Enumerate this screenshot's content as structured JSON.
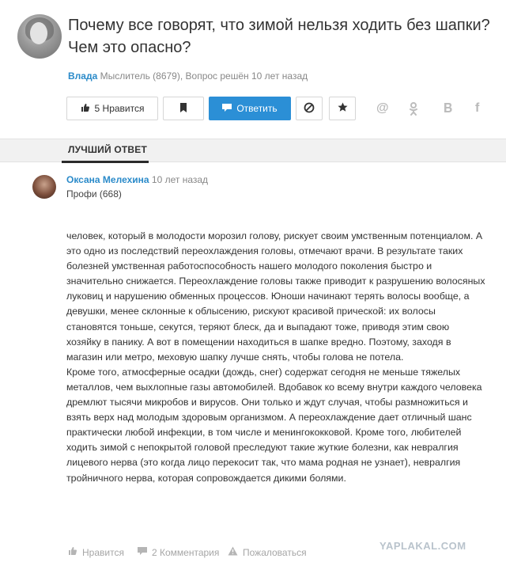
{
  "question": {
    "title": "Почему все говорят, что зимой нельзя ходить без шапки? Чем это опасно?",
    "author": "Влада",
    "meta": "Мыслитель (8679), Вопрос решён 10 лет назад"
  },
  "toolbar": {
    "like_label": "5 Нравится",
    "answer_label": "Ответить"
  },
  "share": {
    "at": "@",
    "ok": "ok",
    "vk": "в",
    "fb": "f"
  },
  "tabs": {
    "best_answer": "ЛУЧШИЙ ОТВЕТ"
  },
  "answer": {
    "author": "Оксана Мелехина",
    "time": "10 лет назад",
    "rank": "Профи (668)",
    "paragraphs": [
      " человек, который в молодости морозил голову, рискует своим умственным потенциалом. А это одно из последствий переохлаждения головы, отмечают врачи. В результате таких болезней умственная работоспособность нашего молодого поколения быстро и значительно снижается. Переохлаждение головы также приводит к разрушению волосяных луковиц и нарушению обменных процессов. Юноши начинают терять волосы вообще, а девушки, менее склонные к облысению, рискуют красивой прической: их волосы становятся тоньше, секутся, теряют блеск, да и выпадают тоже, приводя этим свою хозяйку в панику. А вот в помещении находиться в шапке вредно. Поэтому, заходя в магазин или метро, меховую шапку лучше снять, чтобы голова не потела.",
      "Кроме того, атмосферные осадки (дождь, снег) содержат сегодня не меньше тяжелых металлов, чем выхлопные газы автомобилей. Вдобавок ко всему внутри каждого человека дремлют тысячи микробов и вирусов. Они только и ждут случая, чтобы размножиться и взять верх над молодым здоровым организмом. А переохлаждение дает отличный шанс практически любой инфекции, в том числе и менингококковой. Кроме того, любителей ходить зимой с непокрытой головой преследуют такие жуткие болезни, как невралгия лицевого нерва (это когда лицо перекосит так, что мама родная не узнает), невралгия тройничного нерва, которая сопровождается дикими болями."
    ],
    "footer": {
      "like": "Нравится",
      "comments": "2 Комментария",
      "complain": "Пожаловаться"
    }
  },
  "watermark": "YAPLAKAL.COM",
  "colors": {
    "accent": "#2b8fd6",
    "link": "#2a8ac9",
    "muted": "#888888"
  }
}
